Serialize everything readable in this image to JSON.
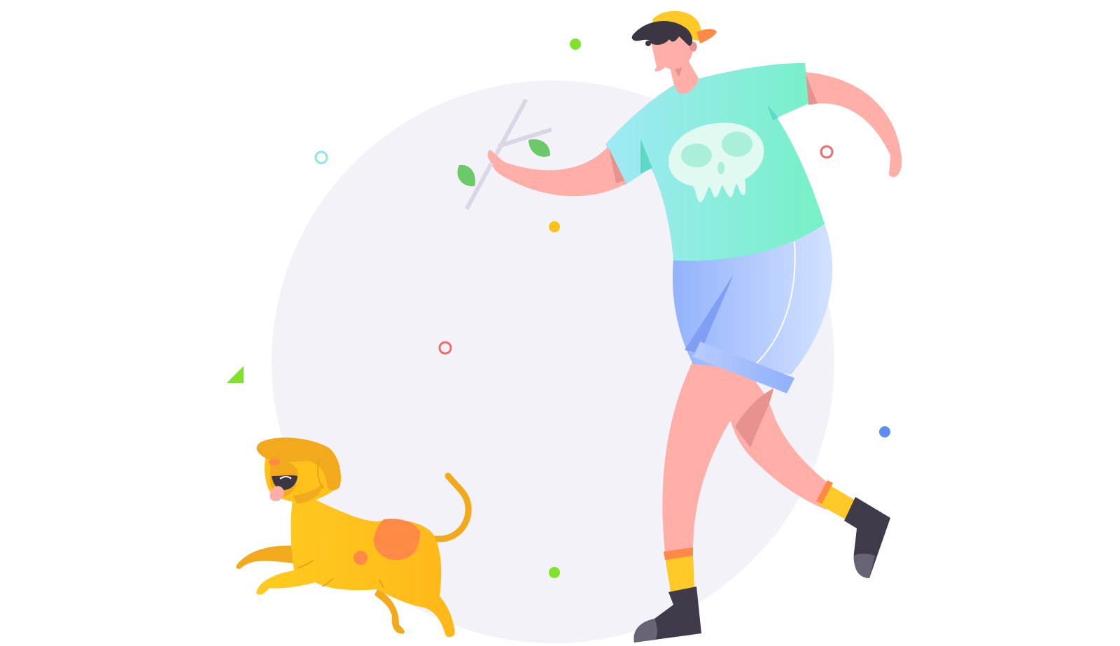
{
  "scene": {
    "subject": "person-running-with-dog",
    "background_color": "#ffffff",
    "backdrop_circle_color": "#f3f2f8"
  },
  "palette": {
    "skin": "#ffaea8",
    "skin_shadow": "#e8928f",
    "hair": "#3c3542",
    "cap": "#ffc928",
    "cap_brim": "#ff8a45",
    "shirt_left": "#9fe9f5",
    "shirt_right": "#76f0c6",
    "skull": "#e0faf2",
    "skull_eyes": "#a9efd9",
    "shorts_left": "#93b2fb",
    "shorts_right": "#cfe0ff",
    "shorts_fold": "#7e9ff2",
    "sock": "#ffc928",
    "sock_band": "#ff8a45",
    "boot": "#403a4a",
    "boot_sole": "#6a6275",
    "stick": "#d9d6e6",
    "leaf": "#6cc96a",
    "dog_body": "#ffc21a",
    "dog_shadow": "#f2a91b",
    "dog_spot": "#ff8a45",
    "dog_tongue": "#ffaea8"
  },
  "decorations": [
    {
      "shape": "dot",
      "color": "#7ee32a"
    },
    {
      "shape": "dot",
      "color": "#7ee32a"
    },
    {
      "shape": "dot",
      "color": "#ffc21a"
    },
    {
      "shape": "dot",
      "color": "#5b8ef0"
    },
    {
      "shape": "ring",
      "color": "#f16b6b"
    },
    {
      "shape": "ring",
      "color": "#f16b6b"
    },
    {
      "shape": "ring",
      "color": "#8ee6e0"
    },
    {
      "shape": "triangle",
      "color": "#7ee32a"
    }
  ]
}
